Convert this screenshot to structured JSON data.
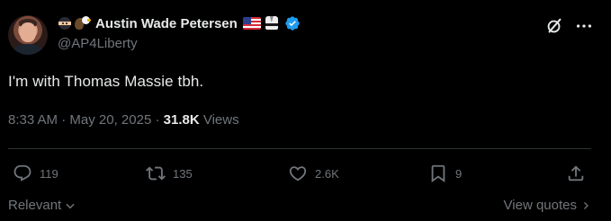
{
  "author": {
    "name": "Austin Wade Petersen",
    "handle": "@AP4Liberty"
  },
  "tweet": {
    "text": "I'm with Thomas Massie tbh.",
    "time": "8:33 AM",
    "separator1": "·",
    "date": "May 20, 2025",
    "separator2": "·",
    "views_count": "31.8K",
    "views_label": "Views"
  },
  "actions": {
    "replies": "119",
    "reposts": "135",
    "likes": "2.6K",
    "bookmarks": "9"
  },
  "footer": {
    "sort_label": "Relevant",
    "view_quotes": "View quotes"
  },
  "colors": {
    "background": "#000000",
    "text_primary": "#e7e9ea",
    "text_secondary": "#71767b",
    "verified_blue": "#1d9bf0",
    "divider": "#2f3336"
  },
  "icons": {
    "name_emojis": [
      "ninja-emoji",
      "eagle-emoji"
    ],
    "name_badges": [
      "us-flag-emoji",
      "martial-arts-uniform-emoji",
      "verified-badge-icon"
    ]
  }
}
